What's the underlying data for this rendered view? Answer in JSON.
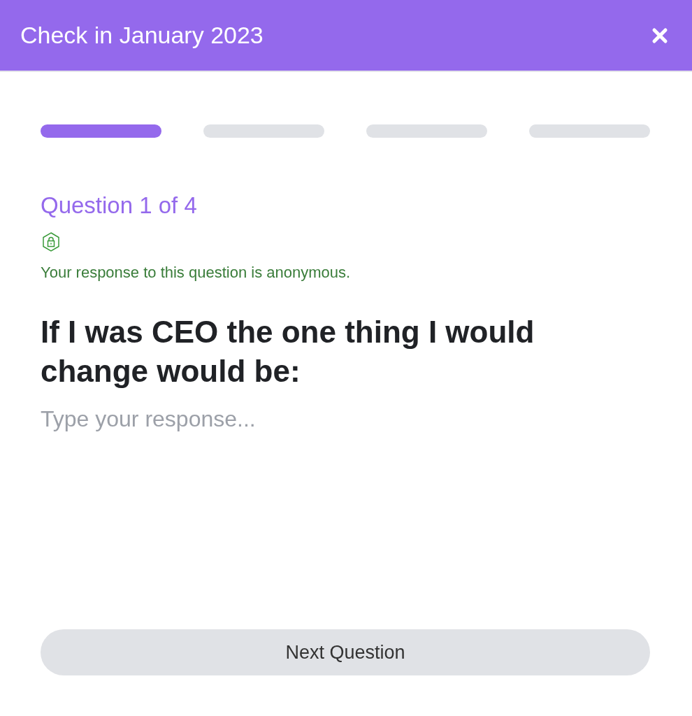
{
  "header": {
    "title": "Check in January 2023"
  },
  "progress_steps": [
    {
      "done": true
    },
    {
      "done": false
    },
    {
      "done": false
    },
    {
      "done": false
    }
  ],
  "question": {
    "counter": "Question 1 of 4",
    "anonymous": true,
    "anonymous_note": "Your response to this question is anonymous.",
    "text": "If I was CEO the one thing I would change would be:"
  },
  "response": {
    "placeholder": "Type your response..."
  },
  "next_button": {
    "label": "Next Question"
  }
}
